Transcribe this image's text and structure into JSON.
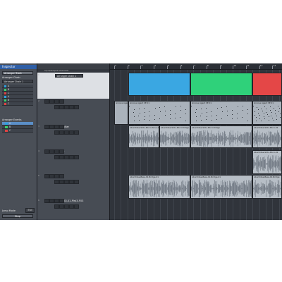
{
  "inspector": {
    "title": "Inspector",
    "selected_track": "Arranger Track",
    "arranger_chain_label": "Arranger Chain",
    "arranger_chain_value": "Arranger Chain 1",
    "sections": [
      {
        "label": "A",
        "color": "#2fa2e0"
      },
      {
        "label": "B",
        "color": "#3bd16c"
      },
      {
        "label": "C",
        "color": "#e04242"
      },
      {
        "label": "A",
        "color": "#2fa2e0"
      },
      {
        "label": "B",
        "color": "#3bd16c"
      },
      {
        "label": "C",
        "color": "#e04242"
      }
    ],
    "arranger_events_label": "Arranger Events",
    "events": [
      {
        "label": "A",
        "color": "#2fa2e0"
      },
      {
        "label": "B",
        "color": "#3bd16c"
      },
      {
        "label": "C",
        "color": "#e04242"
      }
    ],
    "jump_mode_label": "Jump Mode",
    "jump_mode_value": "End",
    "stop_label": "Stop"
  },
  "track_list": {
    "header": "Input/Output Channels",
    "tracks": [
      {
        "num": "1",
        "name": "Arranger Chain 1",
        "type": "arranger"
      },
      {
        "num": "2",
        "name": "Drums"
      },
      {
        "num": "3",
        "name": "Lead Guitar"
      },
      {
        "num": "4",
        "name": "Guitar 2"
      },
      {
        "num": "5",
        "name": "Bass"
      },
      {
        "num": "6",
        "name": "Beatz-BGI-01-Plst3-F03"
      }
    ]
  },
  "ruler": {
    "bars": [
      "1",
      "2",
      "3",
      "4",
      "5",
      "6",
      "7",
      "8",
      "9",
      "10",
      "11",
      "12",
      "13"
    ]
  },
  "parts": {
    "arranger": [
      {
        "label": "",
        "color": "#3aa7e2"
      },
      {
        "label": "",
        "color": "#2fd17a"
      },
      {
        "label": "",
        "color": "#e44747"
      }
    ],
    "drums": [
      "Groove Agent",
      "Groove Agent SE 01",
      "Groove Agent SE 01",
      "Groove Agent SE 01"
    ],
    "lead": [
      "Aboriditee-Stdo-Pbn1-Verse A",
      "Aboriditee-Stdo-Pbn1-Bridge",
      "Aboriditee-Stdo-Pbn1-02"
    ],
    "guitar2": [
      "Aboriditee-Stdo-Pbn1-02"
    ],
    "bass": [
      "Aboriditee-Bass-01-Bridge-01",
      "Aboriditee-Bass-01-Bridge-01",
      "Aboriditee-Bass-01-Bridge"
    ]
  },
  "colors": {
    "waveform": "#9aa7b3",
    "audio_part": "#b7bec6",
    "midi_part": "#aab2bb"
  }
}
